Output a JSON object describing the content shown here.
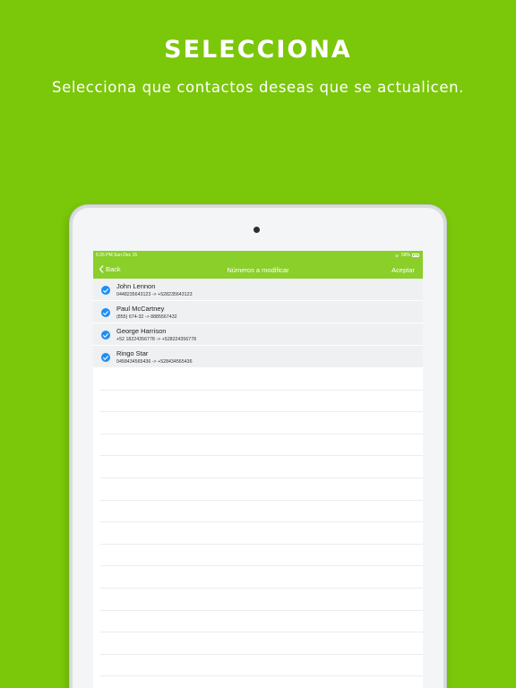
{
  "promo": {
    "headline": "SELECCIONA",
    "subtitle": "Selecciona que contactos deseas que se actualicen."
  },
  "status_bar": {
    "time": "5:26 PM  Sun Dec 15",
    "battery": "58%"
  },
  "navbar": {
    "back_label": "Back",
    "title": "Números a modificar",
    "action_label": "Aceptar"
  },
  "contacts": [
    {
      "name": "John Lennon",
      "numbers": "0448235643123 -> +528235643123",
      "selected": true
    },
    {
      "name": "Paul McCartney",
      "numbers": "(855) 674-32 -> 8885567432",
      "selected": true
    },
    {
      "name": "George Harrison",
      "numbers": "+52 18224356778 -> +528224356778",
      "selected": true
    },
    {
      "name": "Ringo Star",
      "numbers": "0458434565436 -> +528434565436",
      "selected": true
    }
  ],
  "colors": {
    "background": "#7bc70a",
    "accent": "#8acf2a",
    "checkbox": "#1e8ef5"
  },
  "icons": {
    "back": "chevron-left-icon",
    "check": "checkmark-icon",
    "wifi": "wifi-icon",
    "battery": "battery-icon"
  }
}
